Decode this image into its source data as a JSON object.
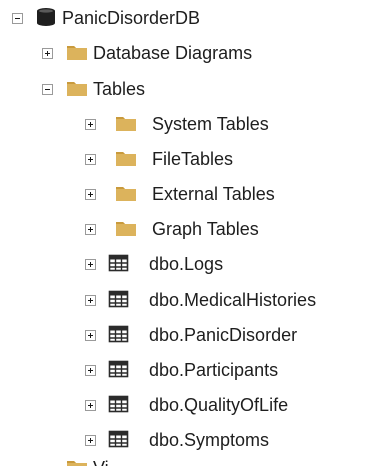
{
  "tree": {
    "database": {
      "label": "PanicDisorderDB",
      "icon": "database-icon",
      "expanded": true
    },
    "folders": [
      {
        "label": "Database Diagrams",
        "icon": "folder-icon",
        "expanded": false
      },
      {
        "label": "Tables",
        "icon": "folder-icon",
        "expanded": true
      }
    ],
    "table_children": [
      {
        "label": "System Tables",
        "icon": "folder-icon",
        "expanded": false
      },
      {
        "label": "FileTables",
        "icon": "folder-icon",
        "expanded": false
      },
      {
        "label": "External Tables",
        "icon": "folder-icon",
        "expanded": false
      },
      {
        "label": "Graph Tables",
        "icon": "folder-icon",
        "expanded": false
      },
      {
        "label": "dbo.Logs",
        "icon": "table-icon",
        "expanded": false
      },
      {
        "label": "dbo.MedicalHistories",
        "icon": "table-icon",
        "expanded": false
      },
      {
        "label": "dbo.PanicDisorder",
        "icon": "table-icon",
        "expanded": false
      },
      {
        "label": "dbo.Participants",
        "icon": "table-icon",
        "expanded": false
      },
      {
        "label": "dbo.QualityOfLife",
        "icon": "table-icon",
        "expanded": false
      },
      {
        "label": "dbo.Symptoms",
        "icon": "table-icon",
        "expanded": false
      }
    ],
    "partial_next": {
      "label": "Vi",
      "icon": "folder-icon"
    }
  },
  "colors": {
    "folder": "#dcb35c",
    "folder_tab": "#c99a3c",
    "db": "#1f1f1f",
    "table_grid": "#2b2b2b",
    "text": "#1e1e1e",
    "expander_border": "#9a9a9a"
  }
}
